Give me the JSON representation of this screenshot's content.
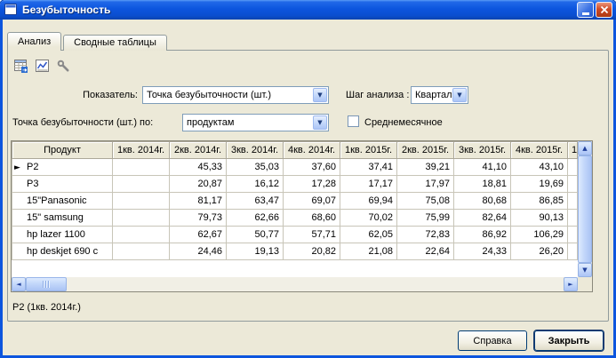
{
  "colors": {
    "titlebar-blue": "#0C55DE",
    "close-red": "#CE4B27",
    "dialog-bg": "#ECE9D8"
  },
  "window": {
    "title": "Безубыточность"
  },
  "tabs": [
    {
      "label": "Анализ",
      "active": true
    },
    {
      "label": "Сводные таблицы",
      "active": false
    }
  ],
  "toolbar": {
    "icons": [
      "table-report-icon",
      "line-chart-icon",
      "wrench-icon"
    ]
  },
  "filters": {
    "indicator_label": "Показатель:",
    "indicator_value": "Точка безубыточности (шт.)",
    "step_label": "Шаг анализа :",
    "step_value": "Квартал",
    "by_label": "Точка безубыточности (шт.) по:",
    "by_value": "продуктам",
    "average_label": "Среднемесячное",
    "average_checked": false
  },
  "grid": {
    "columns": [
      "Продукт",
      "1кв. 2014г.",
      "2кв. 2014г.",
      "3кв. 2014г.",
      "4кв. 2014г.",
      "1кв. 2015г.",
      "2кв. 2015г.",
      "3кв. 2015г.",
      "4кв. 2015г."
    ],
    "partial_header": "1",
    "rows": [
      {
        "product": "P2",
        "current": true,
        "values": [
          "",
          "45,33",
          "35,03",
          "37,60",
          "37,41",
          "39,21",
          "41,10",
          "43,10"
        ]
      },
      {
        "product": "P3",
        "current": false,
        "values": [
          "",
          "20,87",
          "16,12",
          "17,28",
          "17,17",
          "17,97",
          "18,81",
          "19,69"
        ]
      },
      {
        "product": "15\"Panasonic",
        "current": false,
        "values": [
          "",
          "81,17",
          "63,47",
          "69,07",
          "69,94",
          "75,08",
          "80,68",
          "86,85"
        ]
      },
      {
        "product": "15\" samsung",
        "current": false,
        "values": [
          "",
          "79,73",
          "62,66",
          "68,60",
          "70,02",
          "75,99",
          "82,64",
          "90,13"
        ]
      },
      {
        "product": "hp lazer 1100",
        "current": false,
        "values": [
          "",
          "62,67",
          "50,77",
          "57,71",
          "62,05",
          "72,83",
          "86,92",
          "106,29"
        ]
      },
      {
        "product": "hp deskjet 690 c",
        "current": false,
        "values": [
          "",
          "24,46",
          "19,13",
          "20,82",
          "21,08",
          "22,64",
          "24,33",
          "26,20"
        ]
      }
    ]
  },
  "status": "P2 (1кв. 2014г.)",
  "buttons": {
    "help": "Справка",
    "close": "Закрыть"
  }
}
